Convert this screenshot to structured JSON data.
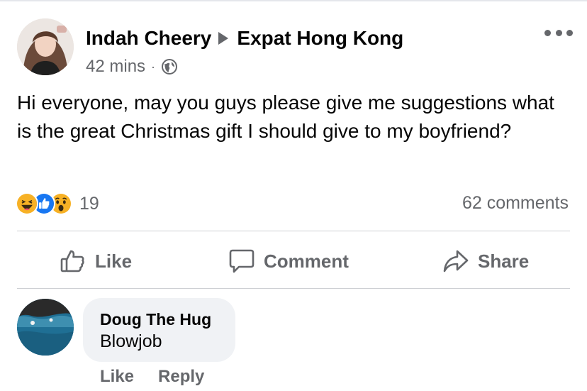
{
  "post": {
    "author": "Indah Cheery",
    "group": "Expat Hong Kong",
    "time": "42 mins",
    "separator": "·",
    "privacy_icon": "globe-icon",
    "text": "Hi everyone, may you guys please give me suggestions what is the great Christmas gift I should give to my boyfriend?"
  },
  "stats": {
    "reaction_icons": [
      "haha-icon",
      "like-icon",
      "wow-icon"
    ],
    "reaction_count": "19",
    "comments": "62 comments"
  },
  "actions": {
    "like": "Like",
    "comment": "Comment",
    "share": "Share"
  },
  "comment": {
    "author": "Doug The Hug",
    "text": "Blowjob",
    "like": "Like",
    "reply": "Reply"
  },
  "colors": {
    "secondary_text": "#65676b",
    "bubble_bg": "#f0f2f5",
    "divider": "#ced0d4",
    "like_blue": "#1877f2",
    "reaction_yellow": "#f7b125"
  }
}
